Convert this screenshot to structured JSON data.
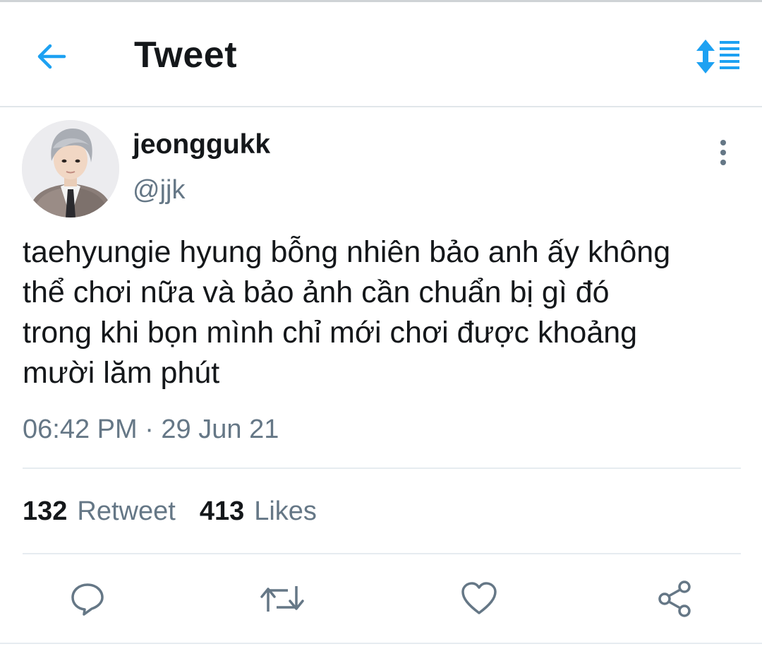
{
  "header": {
    "title": "Tweet",
    "back_icon": "arrow-left-icon",
    "sort_icon": "sort-lines-icon",
    "accent_color": "#1da1f2"
  },
  "tweet": {
    "display_name": "jeonggukk",
    "handle": "@jjk",
    "avatar_icon": "profile-photo",
    "more_icon": "more-vertical-icon",
    "text": "taehyungie hyung bỗng nhiên bảo anh ấy không\nthể chơi nữa và bảo ảnh cần chuẩn bị gì đó\ntrong khi bọn mình chỉ mới chơi được khoảng\nmười lăm phút",
    "timestamp": "06:42 PM · 29 Jun 21"
  },
  "stats": {
    "retweets_count": "132",
    "retweets_label": "Retweet",
    "likes_count": "413",
    "likes_label": "Likes"
  },
  "actions": [
    {
      "name": "reply",
      "icon": "reply-icon"
    },
    {
      "name": "retweet",
      "icon": "retweet-icon"
    },
    {
      "name": "like",
      "icon": "heart-icon"
    },
    {
      "name": "share",
      "icon": "share-icon"
    }
  ],
  "colors": {
    "text_primary": "#14171a",
    "text_secondary": "#657786",
    "divider": "#e6ecf0"
  }
}
